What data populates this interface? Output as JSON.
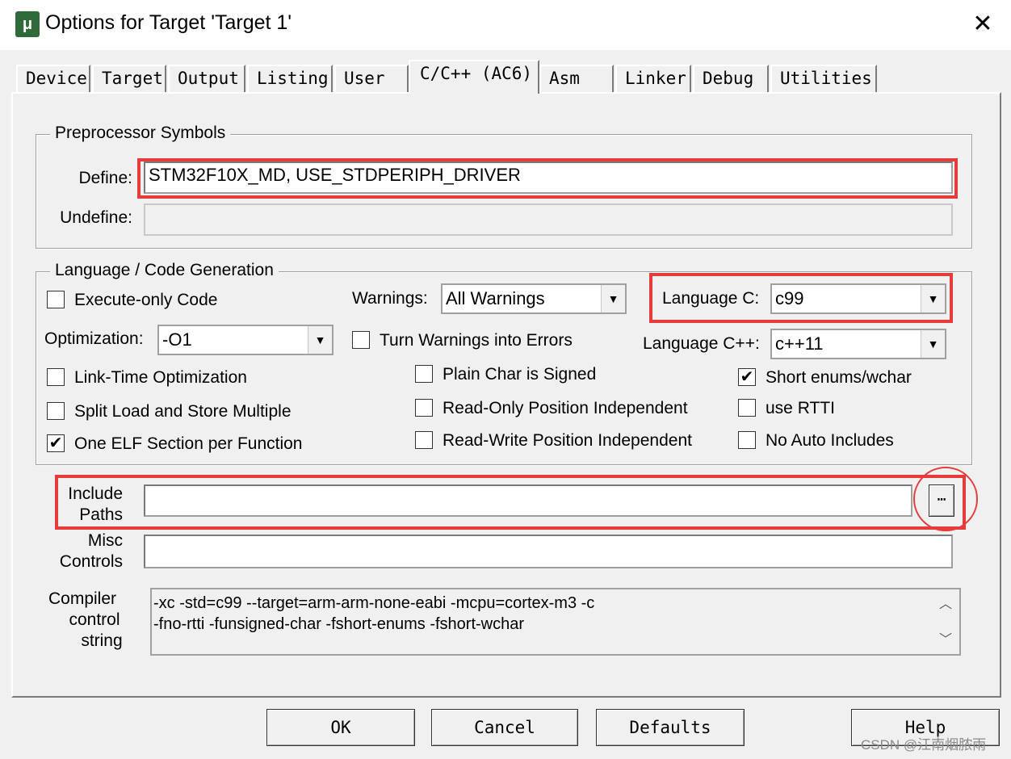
{
  "window": {
    "title": "Options for Target 'Target 1'",
    "app_icon_glyph": "μ",
    "close_glyph": "✕"
  },
  "tabs": [
    {
      "label": "Device"
    },
    {
      "label": "Target"
    },
    {
      "label": "Output"
    },
    {
      "label": "Listing"
    },
    {
      "label": "User"
    },
    {
      "label": "C/C++ (AC6)",
      "active": true
    },
    {
      "label": "Asm"
    },
    {
      "label": "Linker"
    },
    {
      "label": "Debug"
    },
    {
      "label": "Utilities"
    }
  ],
  "preprocessor": {
    "group_title": "Preprocessor Symbols",
    "define_label": "Define:",
    "define_value": "STM32F10X_MD, USE_STDPERIPH_DRIVER",
    "undefine_label": "Undefine:",
    "undefine_value": ""
  },
  "language": {
    "group_title": "Language / Code Generation",
    "execute_only": {
      "label": "Execute-only Code",
      "checked": false
    },
    "optimization_label": "Optimization:",
    "optimization_value": "-O1",
    "link_time_opt": {
      "label": "Link-Time Optimization",
      "checked": false
    },
    "split_load_store": {
      "label": "Split Load and Store Multiple",
      "checked": false
    },
    "one_elf_section": {
      "label": "One ELF Section per Function",
      "checked": true
    },
    "warnings_label": "Warnings:",
    "warnings_value": "All Warnings",
    "turn_warnings_errors": {
      "label": "Turn Warnings into Errors",
      "checked": false
    },
    "plain_char_signed": {
      "label": "Plain Char is Signed",
      "checked": false
    },
    "ro_pos_indep": {
      "label": "Read-Only Position Independent",
      "checked": false
    },
    "rw_pos_indep": {
      "label": "Read-Write Position Independent",
      "checked": false
    },
    "language_c_label": "Language C:",
    "language_c_value": "c99",
    "language_cpp_label": "Language C++:",
    "language_cpp_value": "c++11",
    "short_enums": {
      "label": "Short enums/wchar",
      "checked": true
    },
    "use_rtti": {
      "label": "use RTTI",
      "checked": false
    },
    "no_auto_includes": {
      "label": "No Auto Includes",
      "checked": false
    }
  },
  "include_paths": {
    "label_line1": "Include",
    "label_line2": "Paths",
    "value": "",
    "browse_glyph": "⋯"
  },
  "misc_controls": {
    "label_line1": "Misc",
    "label_line2": "Controls",
    "value": ""
  },
  "compiler_string": {
    "label_line1": "Compiler",
    "label_line2": "control",
    "label_line3": "string",
    "line1": "-xc -std=c99 --target=arm-arm-none-eabi -mcpu=cortex-m3 -c",
    "line2": "-fno-rtti -funsigned-char -fshort-enums -fshort-wchar"
  },
  "buttons": {
    "ok": "OK",
    "cancel": "Cancel",
    "defaults": "Defaults",
    "help": "Help"
  },
  "watermark": "CSDN @江南烟脓雨",
  "colors": {
    "highlight": "#e63b3b",
    "dialog_bg": "#f0f0f0"
  }
}
